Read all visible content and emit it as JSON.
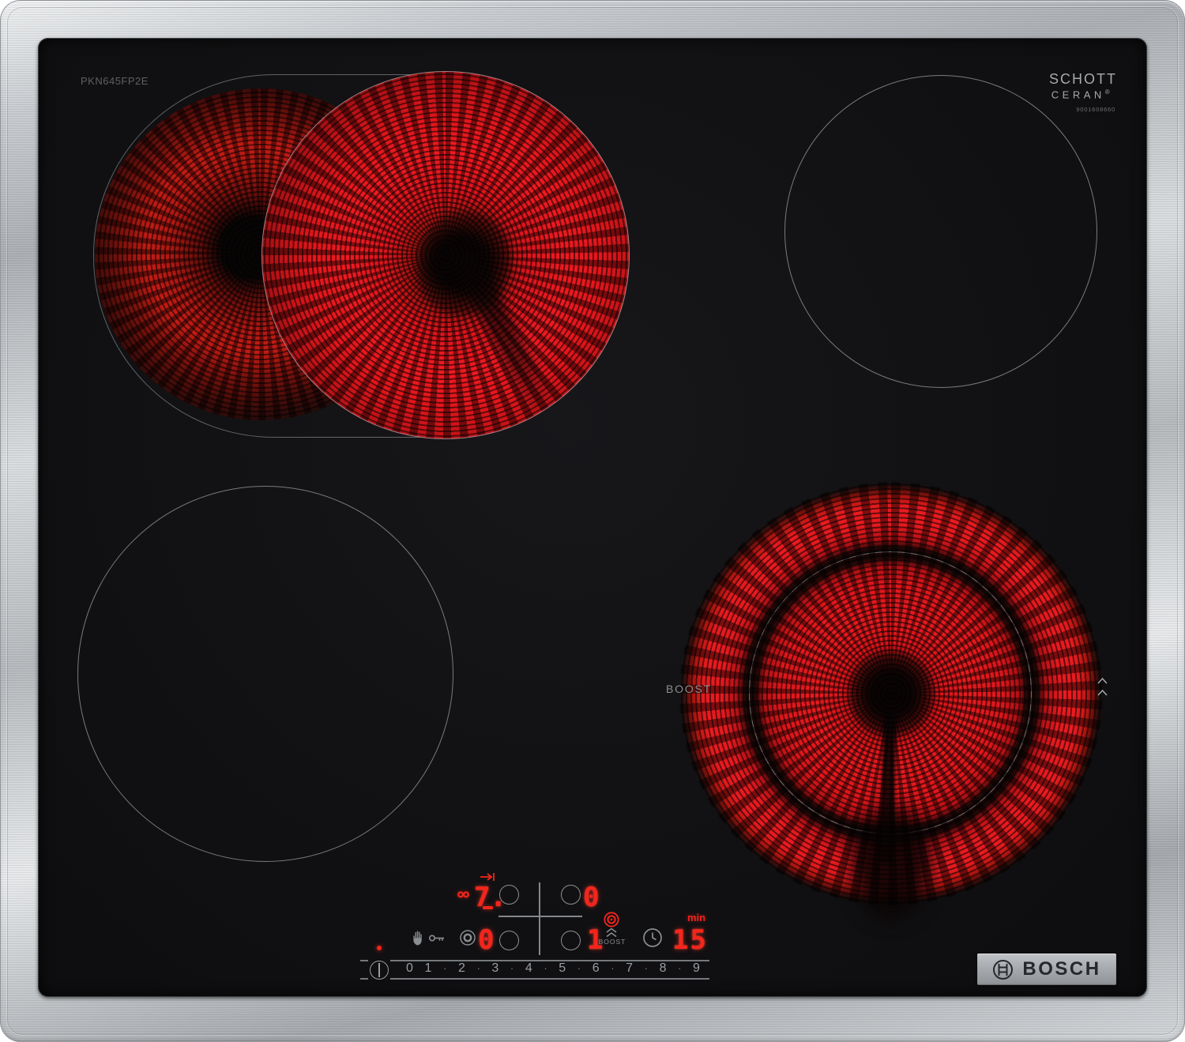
{
  "product": {
    "model_number": "PKN645FP2E",
    "brand_badge": "BOSCH",
    "glass_brand": {
      "line1": "SCHOTT",
      "line2": "CERAN",
      "registered_mark": "®",
      "print_code": "9001608660"
    }
  },
  "glass_markings": {
    "boost_zone_label": "BOOST"
  },
  "control_panel": {
    "zone_levels": {
      "top_left": "7.",
      "top_right": "0",
      "bottom_left": "0",
      "bottom_right": "1"
    },
    "dual_zone_symbol": "∞",
    "boost_label": "BOOST",
    "timer": {
      "value": "15",
      "unit": "min"
    },
    "slider": {
      "levels": [
        "0",
        "1",
        "2",
        "3",
        "4",
        "5",
        "6",
        "7",
        "8",
        "9"
      ],
      "separator": "·"
    }
  },
  "icons": {
    "power": "circle-with-vertical-bar",
    "child_lock_hand": "raised-hand",
    "child_lock_key": "key",
    "dual_circuit_select": "gray-bullseye",
    "boost_bullseye": "red-bullseye",
    "boost_chevrons": "double-chevron-up",
    "timer_clock": "clock-face",
    "zone_extension": "arrow-to-bar",
    "bosch_armature": "circle-with-armature",
    "boost_glass_chevrons": "double-chevron-up"
  },
  "colors": {
    "display_red": "#f5251b",
    "glow_red": "#e8161c",
    "panel_gray": "#8d9093",
    "glass_black": "#121214",
    "steel_frame": "#c6c9cc"
  }
}
